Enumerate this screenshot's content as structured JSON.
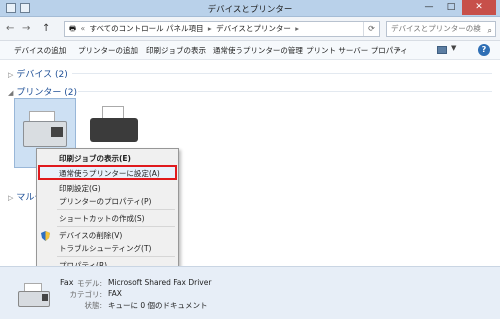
{
  "window": {
    "title": "デバイスとプリンター",
    "minimize_label": "—",
    "maximize_label": "□",
    "close_label": "✕"
  },
  "address": {
    "back_label": "←",
    "forward_label": "→",
    "up_label": "↑",
    "overflow_label": "«",
    "crumbs": [
      "すべてのコントロール パネル項目",
      "デバイスとプリンター"
    ],
    "search_placeholder": "デバイスとプリンターの検索"
  },
  "toolbar": {
    "add_device": "デバイスの追加",
    "add_printer": "プリンターの追加",
    "show_print_jobs": "印刷ジョブの表示",
    "manage_default_printer": "通常使うプリンターの管理",
    "print_server_properties": "プリント サーバー プロパティ",
    "more": "»"
  },
  "groups": {
    "devices": "デバイス (2)",
    "printers": "プリンター (2)",
    "multimedia_partial": "マルチ"
  },
  "context_menu": {
    "items": [
      "印刷ジョブの表示(E)",
      "通常使うプリンターに設定(A)",
      "印刷設定(G)",
      "プリンターのプロパティ(P)",
      "ショートカットの作成(S)",
      "デバイスの削除(V)",
      "トラブルシューティング(T)",
      "プロパティ(R)"
    ]
  },
  "details": {
    "name": "Fax",
    "model_label": "モデル:",
    "model_value": "Microsoft Shared Fax Driver",
    "category_label": "カテゴリ:",
    "category_value": "FAX",
    "status_label": "状態:",
    "status_value": "キューに 0 個のドキュメント"
  },
  "colors": {
    "highlight_border": "#e0191d",
    "group_header": "#1e4f96",
    "selection_bg": "#cde0f3"
  }
}
